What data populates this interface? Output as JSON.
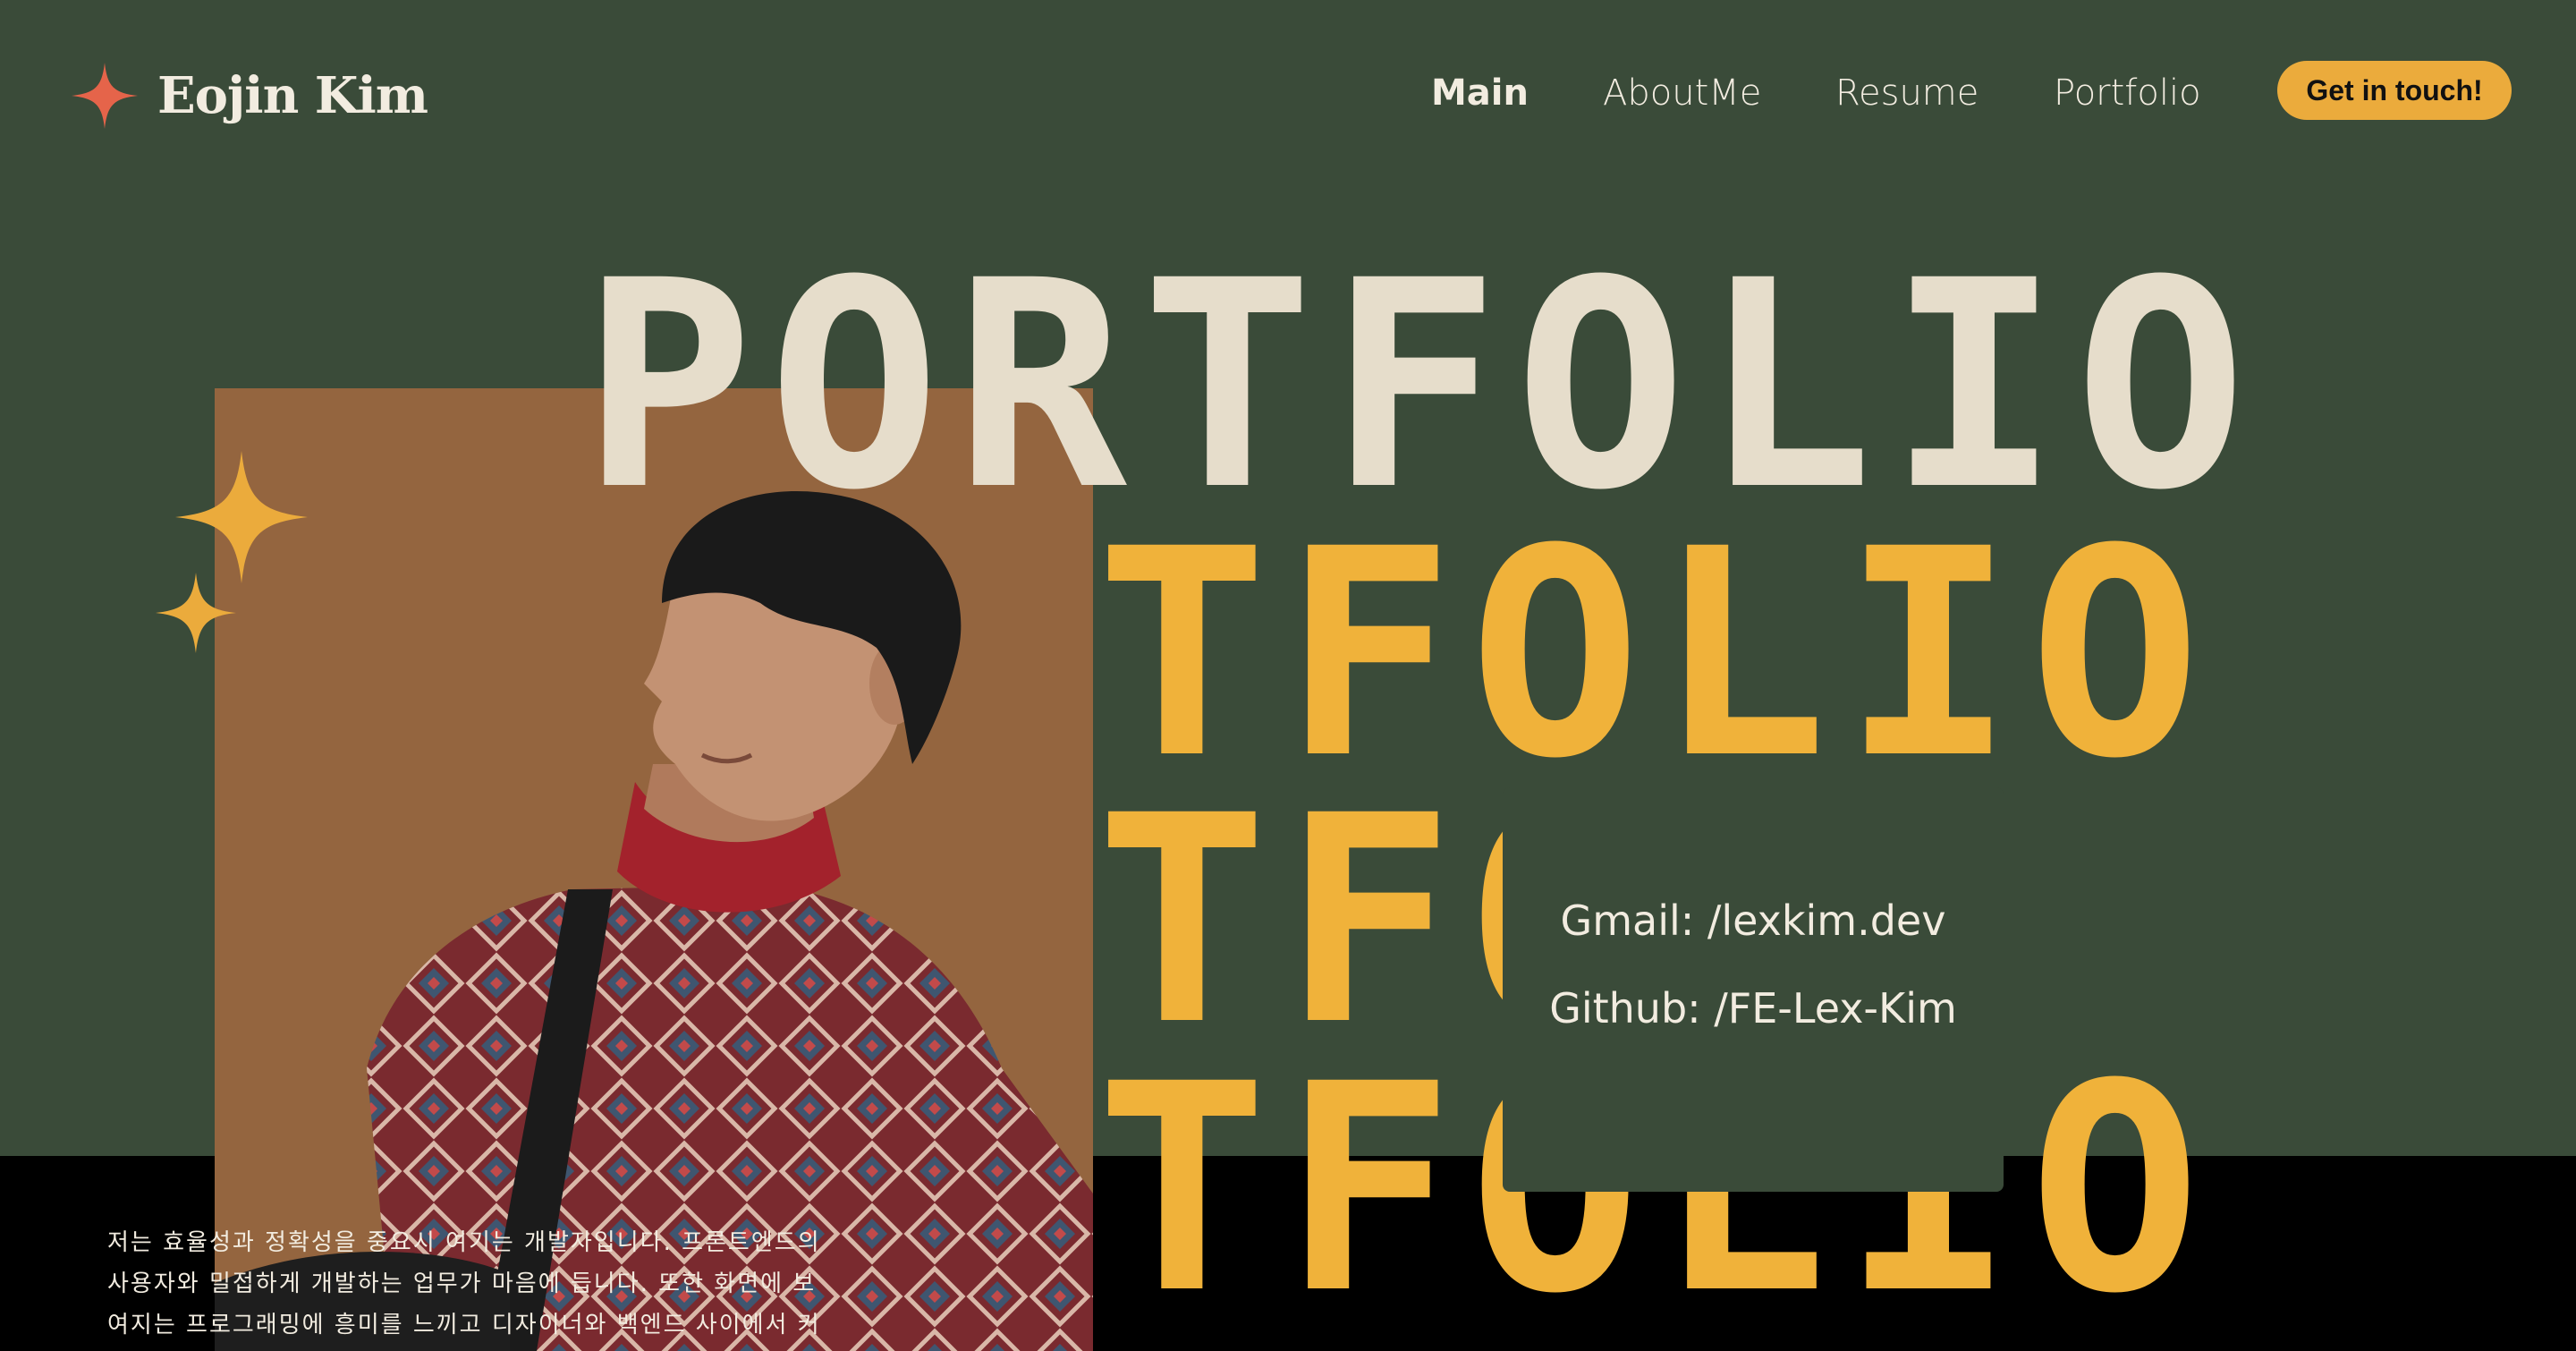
{
  "header": {
    "logo_text": "Eojin Kim",
    "logo_icon": "four-point-star-icon",
    "nav": [
      {
        "label": "Main",
        "active": true
      },
      {
        "label": "AboutMe",
        "active": false
      },
      {
        "label": "Resume",
        "active": false
      },
      {
        "label": "Portfolio",
        "active": false
      }
    ],
    "cta_label": "Get in touch!"
  },
  "hero": {
    "lines": [
      "PORTFOLIO",
      "TFOLIO",
      "TFO",
      "TFOLIO"
    ]
  },
  "contact": {
    "gmail": "Gmail: /lexkim.dev",
    "github": "Github: /FE-Lex-Kim"
  },
  "intro_text": "저는 효율성과 정확성을 중요시 여기는 개발자입니다. 프론트엔드의 사용자와 밀접하게 개발하는 업무가 마음에 듭니다. 또한 화면에 보여지는 프로그래밍에 흥미를 느끼고 디자이너와 백엔드 사이에서 커뮤니케이션하는 것을 즐기고 있습니다.",
  "colors": {
    "background": "#3a4b39",
    "accent_yellow": "#f0b23a",
    "accent_orange": "#e5644a",
    "photo_bg": "#94653f",
    "cream": "#e6ddcb",
    "bottom_band": "#000000"
  }
}
